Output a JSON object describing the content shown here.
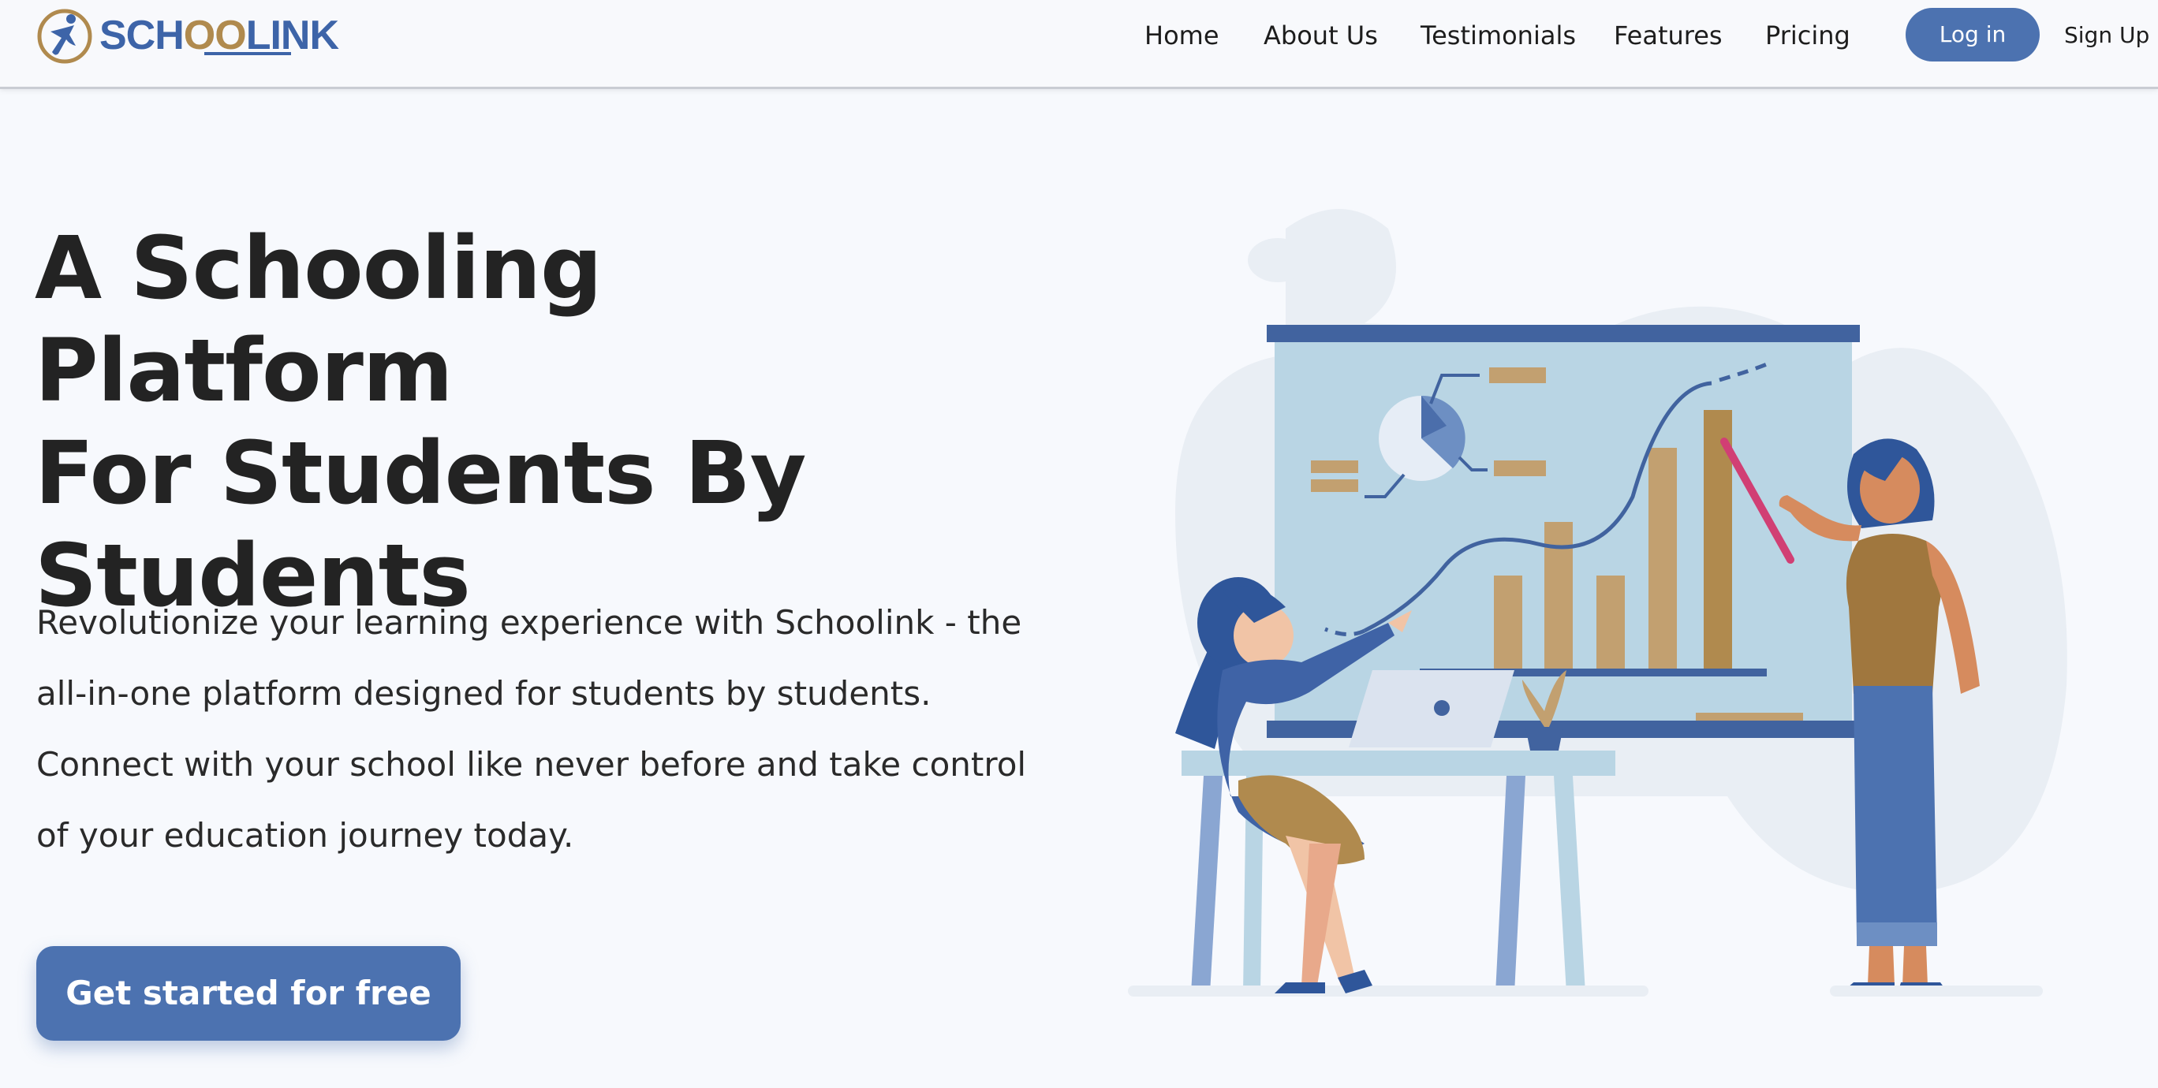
{
  "brand": {
    "name_prefix": "SCH",
    "name_mid": "OO",
    "name_suffix": "LINK",
    "logo_icon": "runner-circle-icon",
    "colors": {
      "primary": "#3d64a8",
      "gold": "#b08a4e"
    }
  },
  "nav": {
    "links": [
      "Home",
      "About Us",
      "Testimonials",
      "Features",
      "Pricing"
    ],
    "login_label": "Log in",
    "signup_label": "Sign Up"
  },
  "hero": {
    "title_line1": "A Schooling Platform",
    "title_line2": "For Students By",
    "title_line3": "Students",
    "description": "Revolutionize your learning experience with Schoolink - the all-in-one platform designed for students by students. Connect with your school like never before and take control of your education journey today.",
    "cta_label": "Get started for free"
  },
  "colors": {
    "accent": "#4c72b0",
    "background": "#f7f9fd",
    "board": "#b9d5e4",
    "bar_gold": "#c2a070"
  },
  "illustration": {
    "icon": "presentation-chart-illustration"
  }
}
